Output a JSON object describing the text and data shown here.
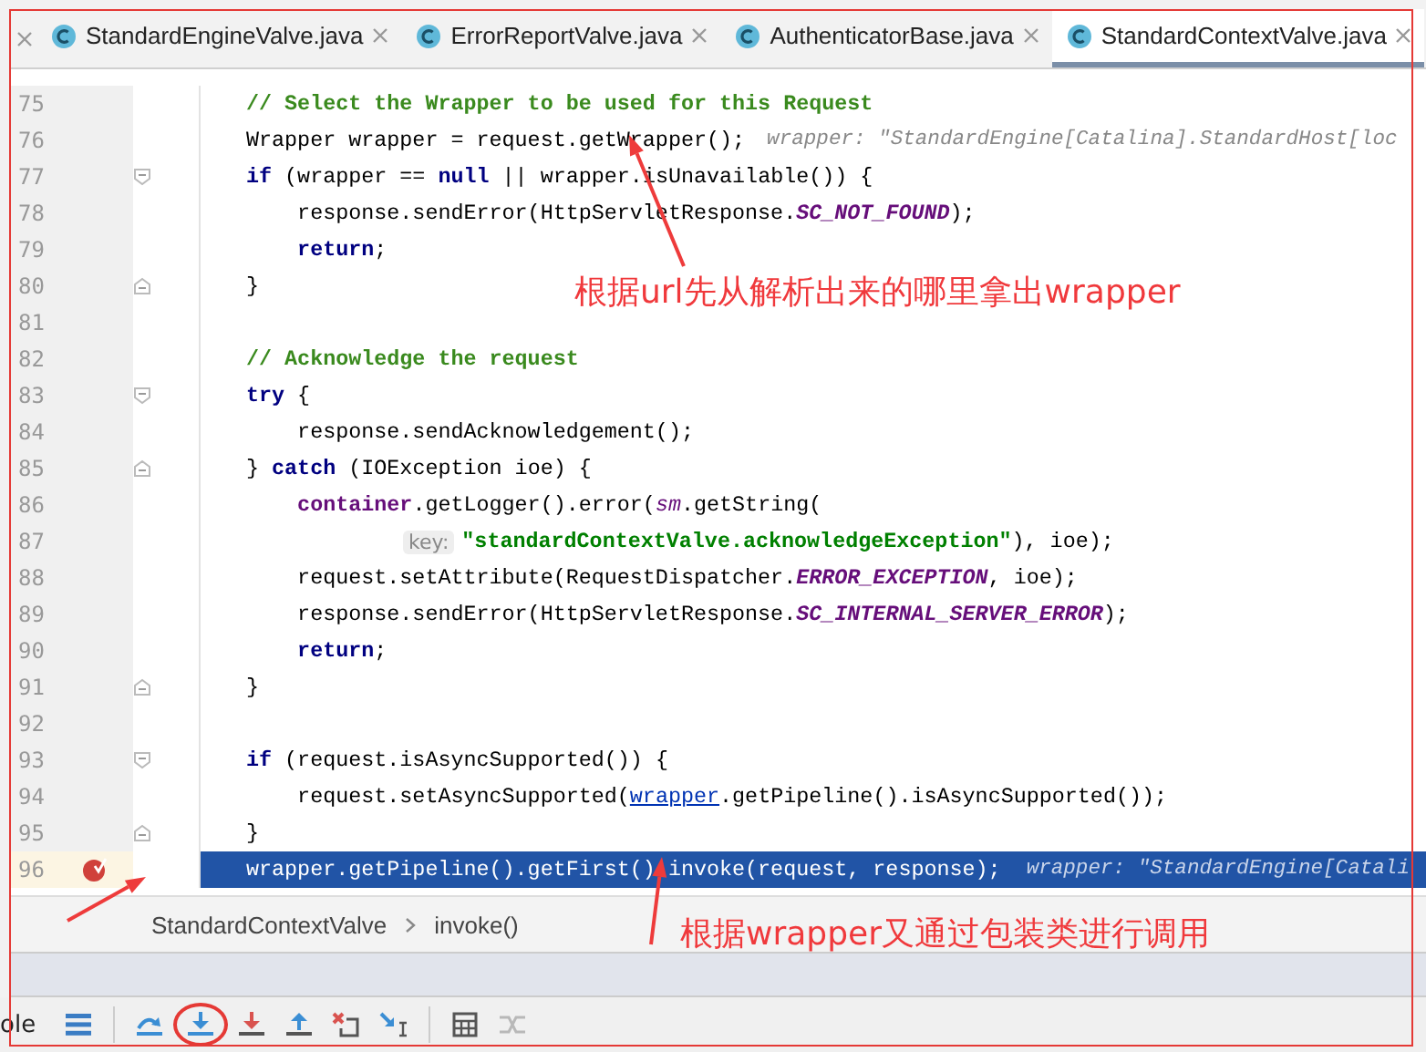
{
  "tabs": [
    {
      "label": "StandardEngineValve.java",
      "selected": false
    },
    {
      "label": "ErrorReportValve.java",
      "selected": false
    },
    {
      "label": "AuthenticatorBase.java",
      "selected": false
    },
    {
      "label": "StandardContextValve.java",
      "selected": true
    }
  ],
  "editor": {
    "lines": [
      {
        "number": "75",
        "tokens": [
          {
            "kind": "comment",
            "text": "// Select the Wrapper to be used for this Request"
          }
        ]
      },
      {
        "number": "76",
        "tokens": [
          {
            "kind": "plain",
            "text": "Wrapper wrapper = request.getWrapper();"
          },
          {
            "kind": "hint",
            "text": "wrapper: \"StandardEngine[Catalina].StandardHost[loc"
          }
        ]
      },
      {
        "number": "77",
        "fold_start": true,
        "tokens": [
          {
            "kind": "keyword",
            "text": "if"
          },
          {
            "kind": "plain",
            "text": " (wrapper == "
          },
          {
            "kind": "keyword",
            "text": "null"
          },
          {
            "kind": "plain",
            "text": " || wrapper.isUnavailable()) {"
          }
        ]
      },
      {
        "number": "78",
        "tokens": [
          {
            "kind": "plain",
            "text": "    response.sendError(HttpServletResponse."
          },
          {
            "kind": "constant",
            "text": "SC_NOT_FOUND"
          },
          {
            "kind": "plain",
            "text": ");"
          }
        ]
      },
      {
        "number": "79",
        "tokens": [
          {
            "kind": "keyword",
            "text": "    return"
          },
          {
            "kind": "plain",
            "text": ";"
          }
        ]
      },
      {
        "number": "80",
        "fold_end": true,
        "tokens": [
          {
            "kind": "plain",
            "text": "}"
          }
        ]
      },
      {
        "number": "81"
      },
      {
        "number": "82",
        "tokens": [
          {
            "kind": "comment",
            "text": "// Acknowledge the request"
          }
        ]
      },
      {
        "number": "83",
        "fold_start": true,
        "tokens": [
          {
            "kind": "keyword",
            "text": "try"
          },
          {
            "kind": "plain",
            "text": " {"
          }
        ]
      },
      {
        "number": "84",
        "tokens": [
          {
            "kind": "plain",
            "text": "    response.sendAcknowledgement();"
          }
        ]
      },
      {
        "number": "85",
        "fold_end": true,
        "tokens": [
          {
            "kind": "plain",
            "text": "} "
          },
          {
            "kind": "keyword",
            "text": "catch"
          },
          {
            "kind": "plain",
            "text": " (IOException ioe) {"
          }
        ]
      },
      {
        "number": "86",
        "tokens": [
          {
            "kind": "field",
            "text": "    container"
          },
          {
            "kind": "plain",
            "text": ".getLogger().error("
          },
          {
            "kind": "static",
            "text": "sm"
          },
          {
            "kind": "plain",
            "text": ".getString("
          }
        ]
      },
      {
        "number": "87",
        "tokens": [
          {
            "kind": "param",
            "text": "key:"
          },
          {
            "kind": "string",
            "text": "\"standardContextValve.acknowledgeException\""
          },
          {
            "kind": "plain",
            "text": "), ioe);"
          }
        ]
      },
      {
        "number": "88",
        "tokens": [
          {
            "kind": "plain",
            "text": "    request.setAttribute(RequestDispatcher."
          },
          {
            "kind": "constant",
            "text": "ERROR_EXCEPTION"
          },
          {
            "kind": "plain",
            "text": ", ioe);"
          }
        ]
      },
      {
        "number": "89",
        "tokens": [
          {
            "kind": "plain",
            "text": "    response.sendError(HttpServletResponse."
          },
          {
            "kind": "constant",
            "text": "SC_INTERNAL_SERVER_ERROR"
          },
          {
            "kind": "plain",
            "text": ");"
          }
        ]
      },
      {
        "number": "90",
        "tokens": [
          {
            "kind": "keyword",
            "text": "    return"
          },
          {
            "kind": "plain",
            "text": ";"
          }
        ]
      },
      {
        "number": "91",
        "fold_end": true,
        "tokens": [
          {
            "kind": "plain",
            "text": "}"
          }
        ]
      },
      {
        "number": "92"
      },
      {
        "number": "93",
        "fold_start": true,
        "tokens": [
          {
            "kind": "keyword",
            "text": "if"
          },
          {
            "kind": "plain",
            "text": " (request.isAsyncSupported()) {"
          }
        ]
      },
      {
        "number": "94",
        "tokens": [
          {
            "kind": "plain",
            "text": "    request.setAsyncSupported("
          },
          {
            "kind": "link",
            "text": "wrapper"
          },
          {
            "kind": "plain",
            "text": ".getPipeline().isAsyncSupported());"
          }
        ]
      },
      {
        "number": "95",
        "fold_end": true,
        "tokens": [
          {
            "kind": "plain",
            "text": "}"
          }
        ]
      },
      {
        "number": "96",
        "current": true,
        "breakpoint": true,
        "tokens": [
          {
            "kind": "plain",
            "text": "wrapper.getPipeline().getFirst().invoke(request, response);"
          },
          {
            "kind": "hint",
            "text": "wrapper: \"StandardEngine[Catali"
          }
        ]
      }
    ]
  },
  "breadcrumb": [
    "StandardContextValve",
    "invoke()"
  ],
  "debug_toolbar": {
    "tab_label": "ole",
    "buttons": [
      {
        "kind": "layout",
        "circled": false
      },
      {
        "kind": "step-over",
        "circled": false
      },
      {
        "kind": "step-into",
        "circled": true
      },
      {
        "kind": "force-step-into",
        "circled": false
      },
      {
        "kind": "step-out",
        "circled": false
      },
      {
        "kind": "drop-frame",
        "circled": false
      },
      {
        "kind": "run-to-cursor",
        "circled": false
      },
      {
        "kind": "evaluate",
        "circled": false
      },
      {
        "kind": "trace",
        "circled": false
      }
    ]
  },
  "annotations": [
    {
      "text": "根据url先从解析出来的哪里拿出wrapper"
    },
    {
      "text": "根据wrapper又通过包装类进行调用"
    }
  ]
}
